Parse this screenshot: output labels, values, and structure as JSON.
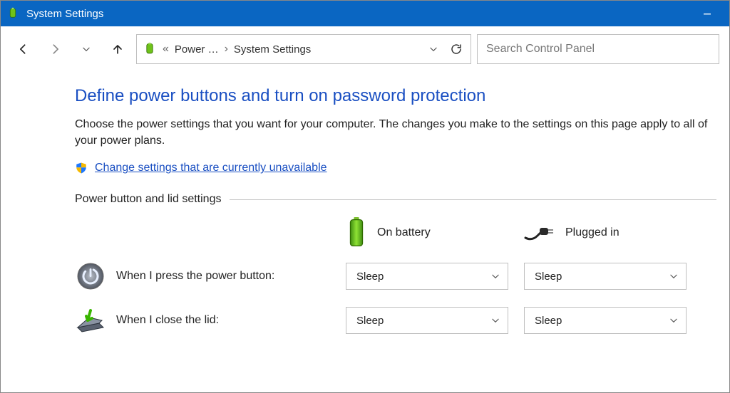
{
  "window": {
    "title": "System Settings"
  },
  "breadcrumb": {
    "ellipsis": "«",
    "item1": "Power …",
    "sep": "›",
    "item2": "System Settings"
  },
  "search": {
    "placeholder": "Search Control Panel"
  },
  "page": {
    "title": "Define power buttons and turn on password protection",
    "description": "Choose the power settings that you want for your computer. The changes you make to the settings on this page apply to all of your power plans.",
    "uac_link": "Change settings that are currently unavailable",
    "section_label": "Power button and lid settings"
  },
  "columns": {
    "battery": "On battery",
    "plugged": "Plugged in"
  },
  "rows": {
    "power_button": {
      "label": "When I press the power button:",
      "battery_value": "Sleep",
      "plugged_value": "Sleep"
    },
    "close_lid": {
      "label": "When I close the lid:",
      "battery_value": "Sleep",
      "plugged_value": "Sleep"
    }
  }
}
